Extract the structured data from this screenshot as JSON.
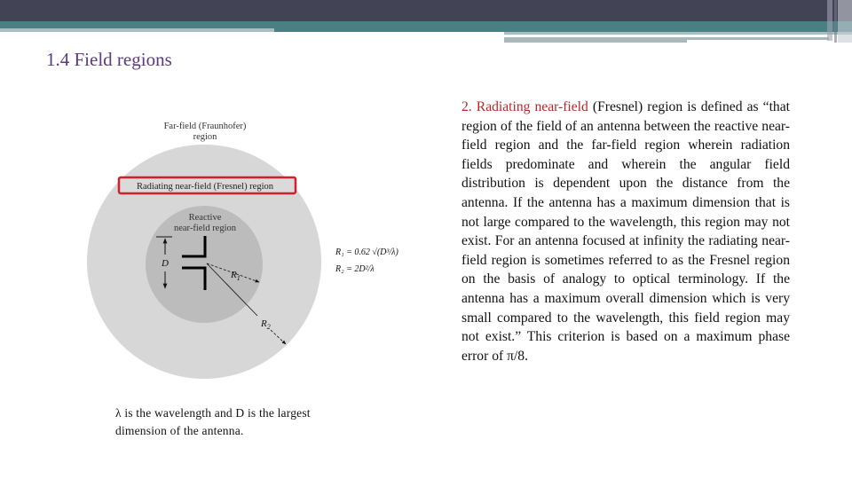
{
  "slide": {
    "title": "1.4 Field regions",
    "theme_colors": {
      "header_dark": "#434356",
      "header_teal": "#4a8084",
      "header_light_teal": "#a5c0c4",
      "title_color": "#5b3a7e",
      "highlight_red": "#b22a2a"
    }
  },
  "diagram": {
    "far_field_label_line1": "Far-field (Fraunhofer)",
    "far_field_label_line2": "region",
    "radiating_label": "Radiating near-field (Fresnel) region",
    "reactive_label_line1": "Reactive",
    "reactive_label_line2": "near-field region",
    "dimension_label": "D",
    "r1_label": "R",
    "r1_sub": "1",
    "r2_label": "R",
    "r2_sub": "2",
    "formula_r1": "R₁ = 0.62 √(D³/λ)",
    "formula_r2": "R₂ = 2D²/λ",
    "colors": {
      "outer_region": "#d7d7d7",
      "inner_region": "#bcbcbc",
      "highlight_box": "#d0202c"
    }
  },
  "caption": {
    "text": "λ is the wavelength and D is the largest dimension of the antenna."
  },
  "body": {
    "highlight": "2. Radiating near-field",
    "text": " (Fresnel) region is defined as “that region of the field of an antenna between the reactive near-field region and the far-field region wherein radiation fields predominate and wherein the angular field distribution is dependent upon the distance from the antenna. If the antenna has a maximum dimension that is not large compared to the wavelength, this region may not exist. For an antenna focused at infinity the radiating near-field region is sometimes referred to as the Fresnel region on the basis of analogy to optical terminology. If the antenna has a maximum overall dimension which is very small compared to the wavelength, this field region may not exist.” This criterion is based on a maximum phase error of π/8."
  }
}
